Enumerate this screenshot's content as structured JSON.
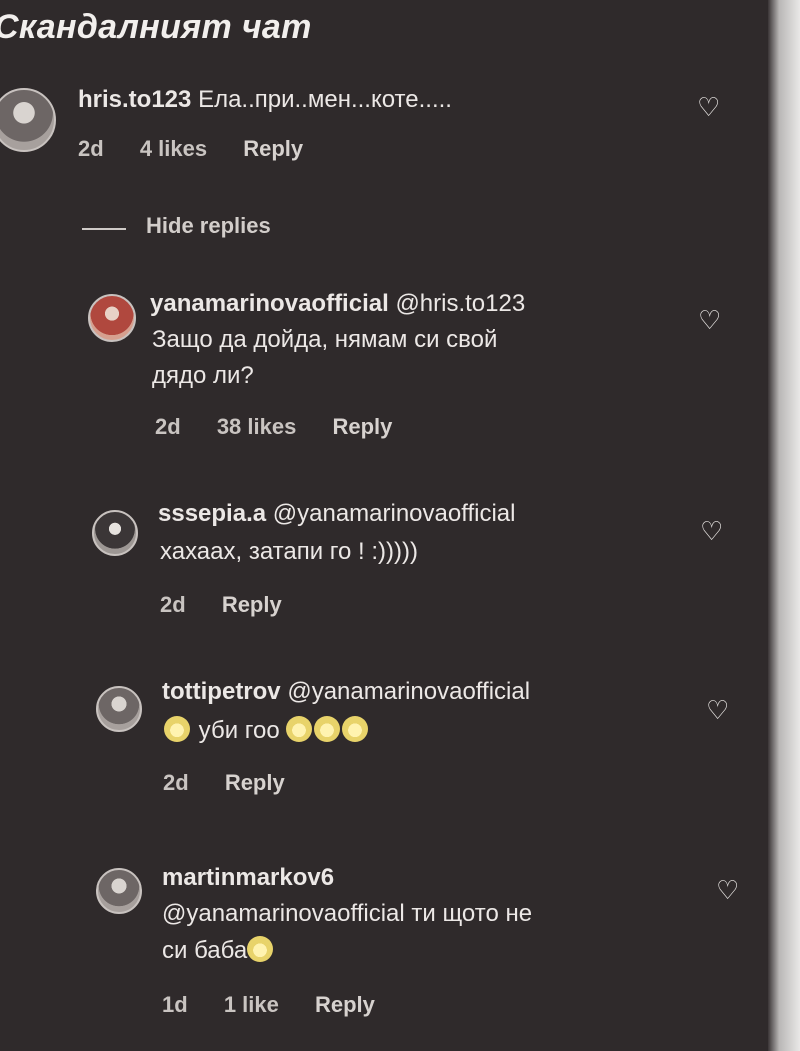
{
  "title": "Скандалният чат",
  "comments": [
    {
      "username": "hris.to123",
      "text": "Ела..при..мен...коте.....",
      "time": "2d",
      "likes": "4 likes",
      "reply": "Reply"
    },
    {
      "username": "yanamarinovaofficial",
      "mention": "@hris.to123",
      "text_line2": "Защо да дойда, нямам си свой",
      "text_line3": "дядо ли?",
      "time": "2d",
      "likes": "38 likes",
      "reply": "Reply"
    },
    {
      "username": "sssepia.a",
      "mention": "@yanamarinovaofficial",
      "text_line2": "хахаах, затапи го ! :)))))",
      "time": "2d",
      "reply": "Reply"
    },
    {
      "username": "tottipetrov",
      "mention": "@yanamarinovaofficial",
      "text_line2": "уби гоо",
      "time": "2d",
      "reply": "Reply"
    },
    {
      "username": "martinmarkov6",
      "text_line2": "@yanamarinovaofficial ти щото не",
      "text_line3": "си баба",
      "time": "1d",
      "likes": "1 like",
      "reply": "Reply"
    }
  ],
  "hide_replies": "Hide replies",
  "icons": {
    "like": "heart-icon",
    "avatar": "avatar",
    "emoji": "laughing-emoji"
  }
}
